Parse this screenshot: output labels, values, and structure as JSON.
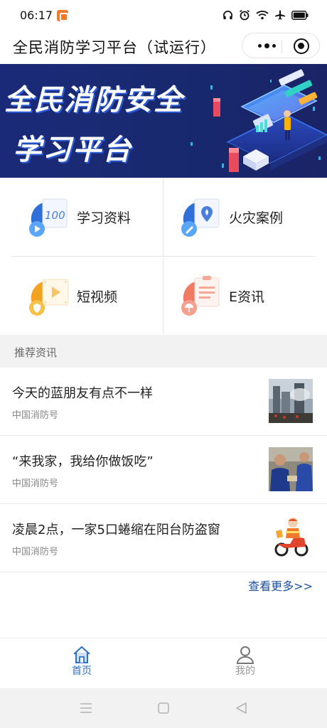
{
  "status_bar": {
    "time": "06:17",
    "icons": [
      "headphones-icon",
      "alarm-icon",
      "wifi-icon",
      "airplane-icon",
      "battery-icon"
    ]
  },
  "title_bar": {
    "title": "全民消防学习平台（试运行）",
    "capsule_icons": [
      "more-dots-icon",
      "close-target-icon"
    ]
  },
  "banner": {
    "line1": "全民消防安全",
    "line2": "学习平台"
  },
  "menu": {
    "items": [
      {
        "label": "学习资料",
        "icon": "study-material-icon"
      },
      {
        "label": "火灾案例",
        "icon": "fire-case-icon"
      },
      {
        "label": "短视频",
        "icon": "short-video-icon"
      },
      {
        "label": "E资讯",
        "icon": "e-news-icon"
      }
    ]
  },
  "section": {
    "title": "推荐资讯"
  },
  "news": {
    "items": [
      {
        "title": "今天的蓝朋友有点不一样",
        "source": "中国消防号"
      },
      {
        "title": "“来我家，我给你做饭吃”",
        "source": "中国消防号"
      },
      {
        "title": "凌晨2点，一家5口蜷缩在阳台防盗窗",
        "source": "中国消防号"
      }
    ],
    "more": "查看更多>>"
  },
  "tabs": {
    "items": [
      {
        "label": "首页",
        "icon": "home-icon",
        "active": true
      },
      {
        "label": "我的",
        "icon": "profile-icon",
        "active": false
      }
    ]
  },
  "system_nav": {
    "icons": [
      "menu-lines-icon",
      "home-square-icon",
      "back-triangle-icon"
    ]
  },
  "colors": {
    "accent": "#1b4f9c",
    "tab_active": "#2f6fc6",
    "tab_inactive": "#999999",
    "banner_bg": "#1b2a78"
  }
}
